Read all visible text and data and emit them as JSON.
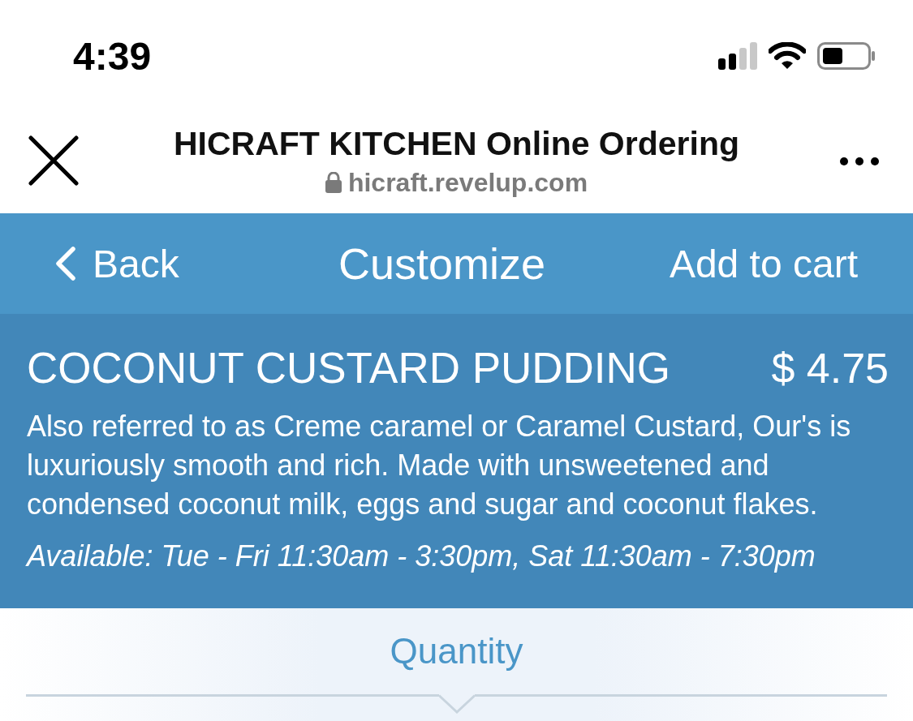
{
  "status_bar": {
    "time": "4:39"
  },
  "browser_bar": {
    "title": "HICRAFT KITCHEN Online Ordering",
    "url": "hicraft.revelup.com"
  },
  "nav_bar": {
    "back": "Back",
    "title": "Customize",
    "action": "Add to cart"
  },
  "item": {
    "name": "COCONUT CUSTARD PUDDING",
    "price": "$ 4.75",
    "description": "Also referred to as Creme caramel or Caramel Custard, Our's is luxuriously smooth and rich. Made with unsweetened and condensed coconut milk, eggs and sugar and coconut flakes.",
    "availability": "Available: Tue - Fri 11:30am - 3:30pm, Sat 11:30am - 7:30pm"
  },
  "section": {
    "title": "Quantity"
  }
}
